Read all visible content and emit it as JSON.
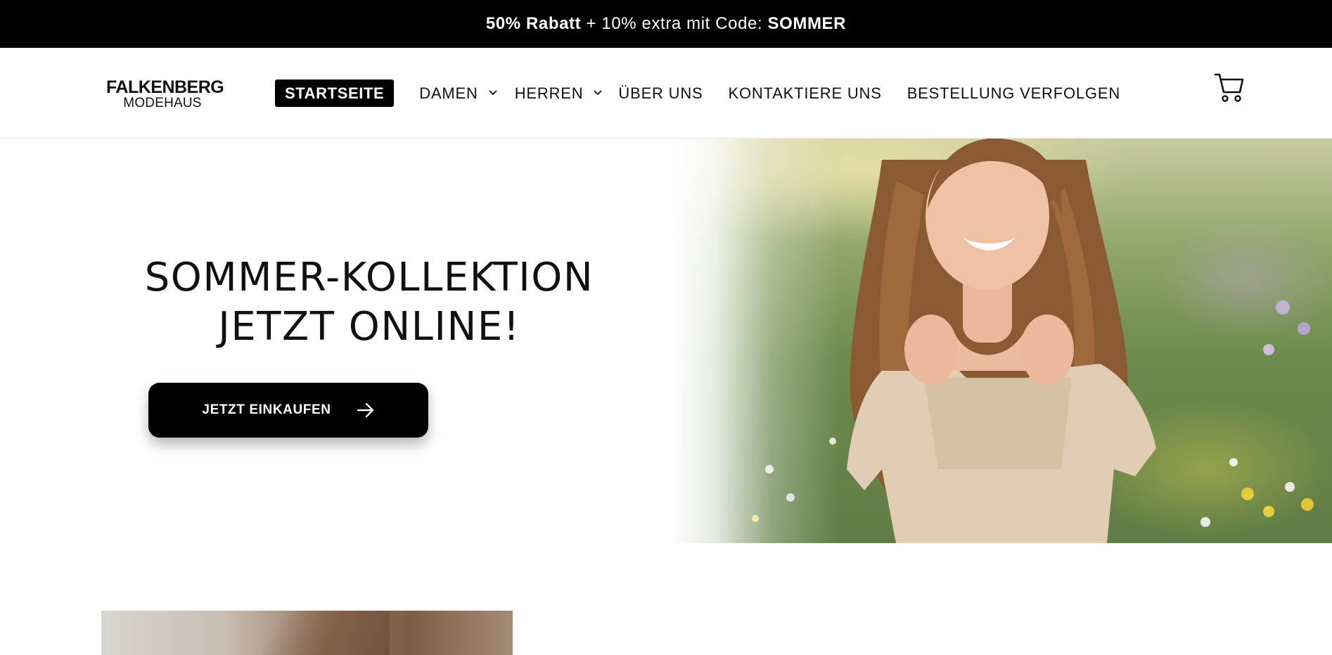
{
  "announcement": {
    "part1": "50% Rabatt",
    "part2": " + 10% extra mit Code: ",
    "code": "SOMMER"
  },
  "header": {
    "logo_line1": "FALKENBERG",
    "logo_line2": "MODEHAUS",
    "nav": [
      {
        "label": "STARTSEITE",
        "active": true
      },
      {
        "label": "DAMEN",
        "dropdown": true
      },
      {
        "label": "HERREN",
        "dropdown": true
      },
      {
        "label": "ÜBER UNS"
      },
      {
        "label": "KONTAKTIERE UNS"
      },
      {
        "label": "BESTELLUNG VERFOLGEN"
      }
    ],
    "cart_icon": "shopping-cart-icon"
  },
  "hero": {
    "headline_line1": "SOMMER-KOLLEKTION",
    "headline_line2": "JETZT ONLINE!",
    "cta_label": "JETZT EINKAUFEN",
    "cta_icon": "arrow-right-icon"
  },
  "colors": {
    "announcement_bg": "#000000",
    "button_bg": "#000000",
    "text": "#111111"
  }
}
